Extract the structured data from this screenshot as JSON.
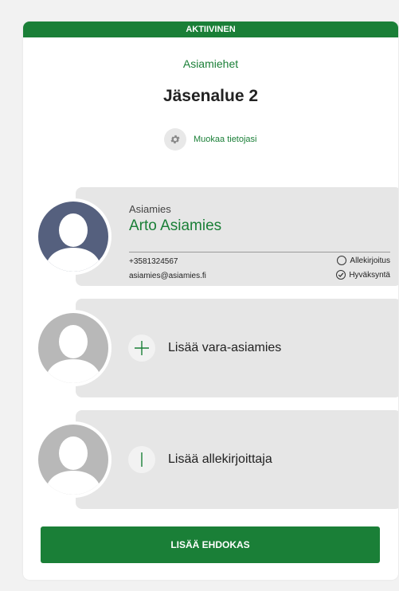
{
  "status": {
    "label": "AKTIIVINEN"
  },
  "header": {
    "section_label": "Asiamiehet",
    "title": "Jäsenalue 2",
    "edit_label": "Muokaa tietojasi"
  },
  "representative": {
    "role": "Asiamies",
    "name": "Arto Asiamies",
    "phone": "+3581324567",
    "email": "asiamies@asiamies.fi",
    "checks": [
      {
        "label": "Allekirjoitus",
        "checked": false
      },
      {
        "label": "Hyväksyntä",
        "checked": true
      }
    ]
  },
  "add_deputy": {
    "label": "Lisää vara-asiamies"
  },
  "add_signatory": {
    "label": "Lisää allekirjoittaja"
  },
  "primary_action": {
    "label": "LISÄÄ EHDOKAS"
  },
  "colors": {
    "accent": "#1a7f37",
    "avatar_active": "#55607e",
    "avatar_inactive": "#b8b8b8",
    "block_bg": "#e6e6e6"
  }
}
